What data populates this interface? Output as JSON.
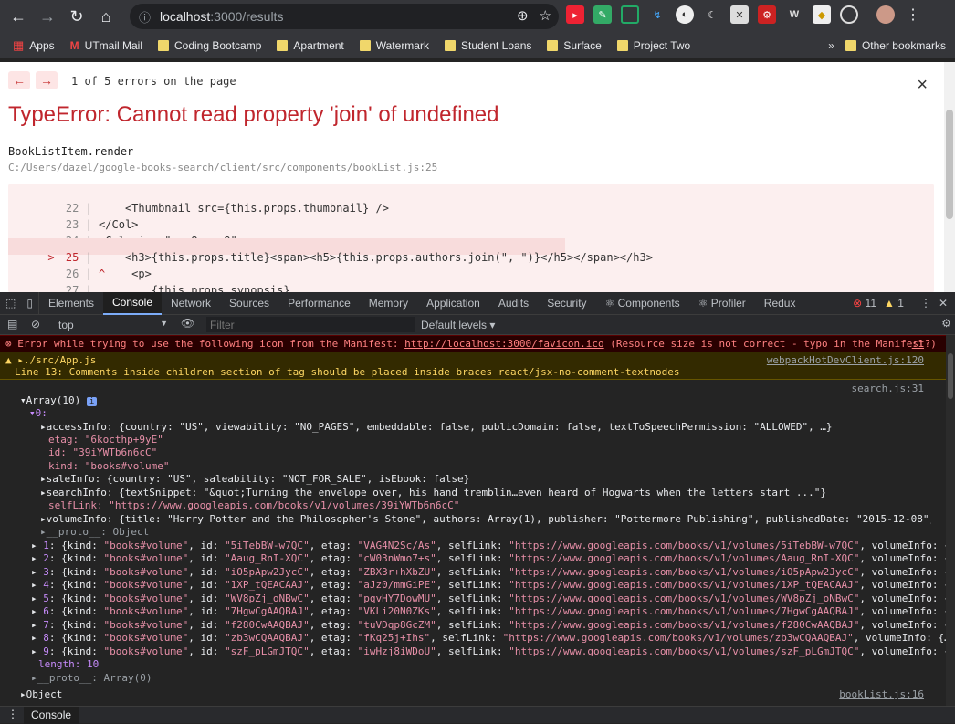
{
  "browser": {
    "url_host": "localhost",
    "url_path": ":3000/results",
    "bookmarks": [
      "Apps",
      "UTmail Mail",
      "Coding Bootcamp",
      "Apartment",
      "Watermark",
      "Student Loans",
      "Surface",
      "Project Two"
    ],
    "other_bookmarks": "Other bookmarks",
    "overflow": "»"
  },
  "overlay": {
    "prev": "←",
    "next": "→",
    "count": "1 of 5 errors on the page",
    "close": "×",
    "title": "TypeError: Cannot read property 'join' of undefined",
    "function": "BookListItem.render",
    "file": "C:/Users/dazel/google-books-search/client/src/components/bookList.js:25",
    "code": [
      {
        "num": "22",
        "text": "    <Thumbnail src={this.props.thumbnail} />"
      },
      {
        "num": "23",
        "text": "</Col>"
      },
      {
        "num": "24",
        "text": "<Col size=\"xs-8 sm-9\">"
      },
      {
        "num": "25",
        "text": "    <h3>{this.props.title}<span><h5>{this.props.authors.join(\", \")}</h5></span></h3>"
      },
      {
        "num": "26",
        "text": "    <p>"
      },
      {
        "num": "27",
        "text": "        {this.props.synopsis}"
      }
    ],
    "marker": ">",
    "caret": "^"
  },
  "devtools": {
    "tabs": [
      "Elements",
      "Console",
      "Network",
      "Sources",
      "Performance",
      "Memory",
      "Application",
      "Audits",
      "Security",
      "⚛ Components",
      "⚛ Profiler",
      "Redux"
    ],
    "error_count": "11",
    "warn_count": "1",
    "context": "top",
    "filter_placeholder": "Filter",
    "levels": "Default levels"
  },
  "console": {
    "error_msg": "Error while trying to use the following icon from the Manifest: ",
    "error_link": "http://localhost:3000/favicon.ico",
    "error_tail": " (Resource size is not correct - typo in the Manifest?)",
    "error_src": ":1",
    "warn_file": "./src/App.js",
    "warn_msg": "  Line 13:  Comments inside children section of tag should be placed inside braces  react/jsx-no-comment-textnodes",
    "warn_src": "webpackHotDevClient.js:120",
    "log_src": "search.js:31",
    "array_label": "Array(10)",
    "index0": "0:",
    "accessInfo": "accessInfo: {country: \"US\", viewability: \"NO_PAGES\", embeddable: false, publicDomain: false, textToSpeechPermission: \"ALLOWED\", …}",
    "etag": "etag: \"6kocthp+9yE\"",
    "id": "id: \"39iYWTb6n6cC\"",
    "kind": "kind: \"books#volume\"",
    "saleInfo": "saleInfo: {country: \"US\", saleability: \"NOT_FOR_SALE\", isEbook: false}",
    "searchInfo": "searchInfo: {textSnippet: \"&quot;Turning the envelope over, his hand tremblin…even heard of Hogwarts when the letters start ...\"}",
    "selfLink": "selfLink: \"https://www.googleapis.com/books/v1/volumes/39iYWTb6n6cC\"",
    "volumeInfo": "volumeInfo: {title: \"Harry Potter and the Philosopher's Stone\", authors: Array(1), publisher: \"Pottermore Publishing\", publishedDate: \"2015-12-08\", description: …",
    "proto_obj": "__proto__: Object",
    "items": [
      {
        "i": "1",
        "id": "5iTebBW-w7QC",
        "etag": "VAG4N2Sc/As"
      },
      {
        "i": "2",
        "id": "Aaug_RnI-XQC",
        "etag": "cW03nWmo7+s"
      },
      {
        "i": "3",
        "id": "iO5pApw2JycC",
        "etag": "ZBX3r+hXbZU"
      },
      {
        "i": "4",
        "id": "1XP_tQEACAAJ",
        "etag": "aJz0/mmGiPE"
      },
      {
        "i": "5",
        "id": "WV8pZj_oNBwC",
        "etag": "pqvHY7DowMU"
      },
      {
        "i": "6",
        "id": "7HgwCgAAQBAJ",
        "etag": "VKLi20N0ZKs"
      },
      {
        "i": "7",
        "id": "f280CwAAQBAJ",
        "etag": "tuVDqp8GcZM"
      },
      {
        "i": "8",
        "id": "zb3wCQAAQBAJ",
        "etag": "fKq25j+Ihs"
      },
      {
        "i": "9",
        "id": "szF_pLGmJTQC",
        "etag": "iwHzj8iWDoU"
      }
    ],
    "length": "length: 10",
    "proto_arr": "__proto__: Array(0)",
    "object_label": "Object",
    "object_src": "bookList.js:16"
  },
  "drawer": {
    "tab": "Console"
  }
}
